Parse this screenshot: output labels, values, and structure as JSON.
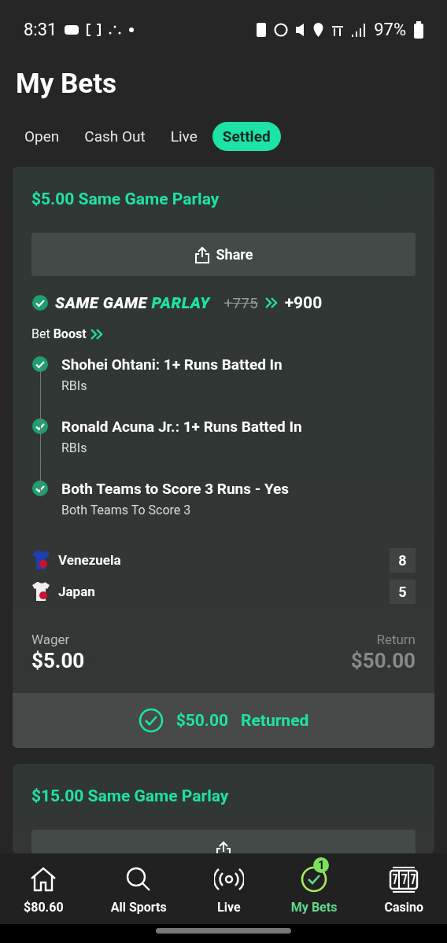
{
  "status_bar": {
    "time": "8:31",
    "battery": "97%"
  },
  "title": "My Bets",
  "tabs": [
    {
      "label": "Open",
      "selected": false
    },
    {
      "label": "Cash Out",
      "selected": false
    },
    {
      "label": "Live",
      "selected": false
    },
    {
      "label": "Settled",
      "selected": true
    }
  ],
  "bets": [
    {
      "title": "$5.00 Same Game Parlay",
      "share": "Share",
      "badge_word_1": "SAME GAME",
      "badge_word_2": "PARLAY",
      "old_odds": "+775",
      "odds": "+900",
      "boost_label": "Bet **Boost**",
      "legs": [
        {
          "name": "Shohei Ohtani: 1+ Runs Batted In",
          "market": "RBIs",
          "won": true
        },
        {
          "name": "Ronald Acuna Jr.: 1+ Runs Batted In",
          "market": "RBIs",
          "won": true
        },
        {
          "name": "Both Teams to Score 3 Runs - Yes",
          "market": "Both Teams To Score 3",
          "won": true
        }
      ],
      "teams": [
        {
          "name": "Venezuela",
          "score": "8",
          "color": "#1f3fb0"
        },
        {
          "name": "Japan",
          "score": "5",
          "color": "#f0f0f0"
        }
      ],
      "wager_label": "Wager",
      "wager": "$5.00",
      "return_label": "Return",
      "return_value": "$50.00",
      "result": {
        "amount": "$50.00",
        "label": "Returned"
      }
    },
    {
      "title": "$15.00 Same Game Parlay"
    }
  ],
  "nav": [
    {
      "label": "$80.60",
      "selected": false
    },
    {
      "label": "All Sports",
      "selected": false
    },
    {
      "label": "Live",
      "selected": false
    },
    {
      "label": "My Bets",
      "selected": true,
      "badge": "1"
    },
    {
      "label": "Casino",
      "selected": false
    }
  ]
}
